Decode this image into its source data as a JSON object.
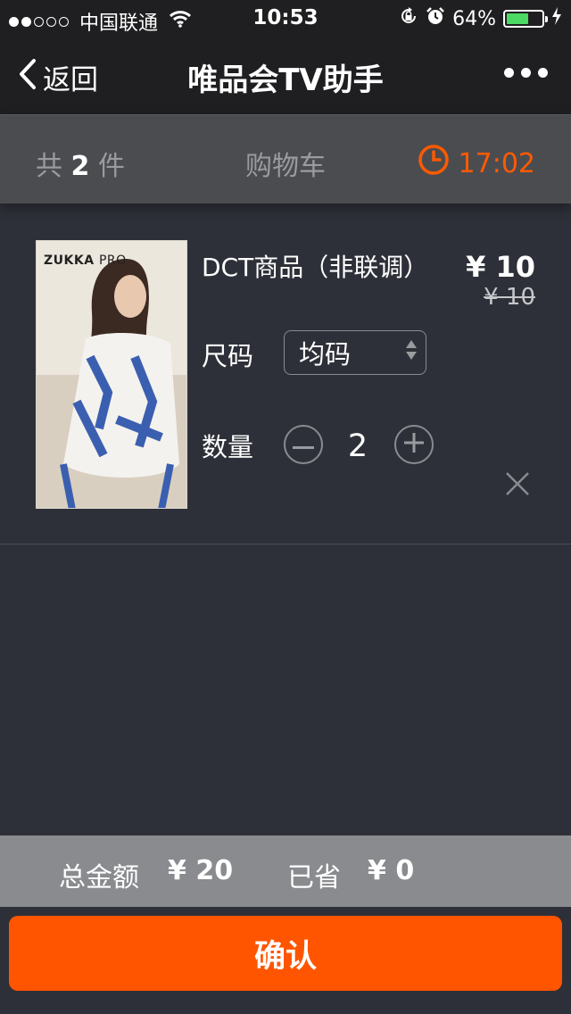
{
  "status_bar": {
    "carrier": "中国联通",
    "time": "10:53",
    "battery": "64%",
    "battery_level": 0.64,
    "signal_bars_filled": 2,
    "signal_bars_total": 5
  },
  "nav": {
    "back_label": "返回",
    "title": "唯品会TV助手"
  },
  "cart_header": {
    "count_prefix": "共",
    "count": "2",
    "count_suffix": "件",
    "title": "购物车",
    "timer": "17:02"
  },
  "item": {
    "brand": "ZUKKA",
    "brand_suffix": "PRO",
    "name": "DCT商品（非联调）",
    "price": "¥ 10",
    "original_price": "¥ 10",
    "size_label": "尺码",
    "size_value": "均码",
    "quantity_label": "数量",
    "quantity": "2"
  },
  "summary": {
    "total_label": "总金额",
    "total_value": "¥ 20",
    "saved_label": "已省",
    "saved_value": "¥ 0"
  },
  "confirm_label": "确认",
  "colors": {
    "accent": "#ff5500",
    "background": "#2e3039",
    "header_bar": "#1f1f21",
    "summary_bar": "#8a8b8f"
  }
}
